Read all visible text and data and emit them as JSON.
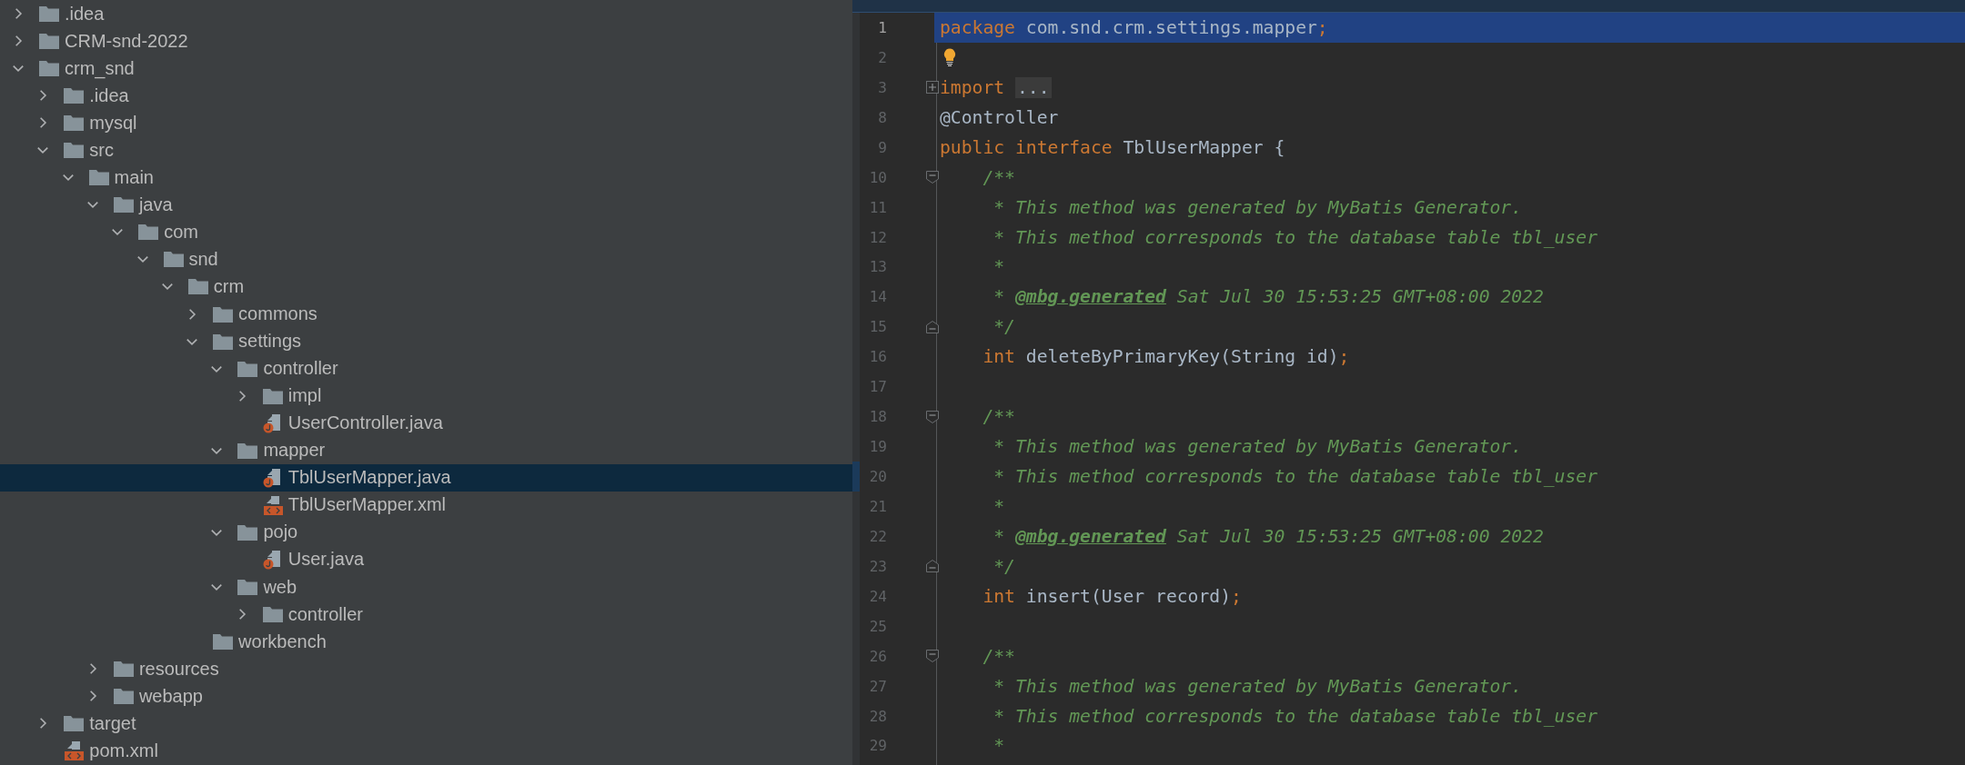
{
  "project_tree": [
    {
      "kind": "folder",
      "label": ".idea",
      "expanded": false,
      "selected": false
    },
    {
      "kind": "folder",
      "label": "CRM-snd-2022",
      "expanded": false,
      "selected": false
    },
    {
      "kind": "folder",
      "label": "crm_snd",
      "expanded": true,
      "selected": false,
      "children": [
        {
          "kind": "folder",
          "label": ".idea",
          "expanded": false,
          "selected": false
        },
        {
          "kind": "folder",
          "label": "mysql",
          "expanded": false,
          "selected": false
        },
        {
          "kind": "folder",
          "label": "src",
          "expanded": true,
          "selected": false,
          "children": [
            {
              "kind": "folder",
              "label": "main",
              "expanded": true,
              "selected": false,
              "children": [
                {
                  "kind": "folder",
                  "label": "java",
                  "expanded": true,
                  "selected": false,
                  "children": [
                    {
                      "kind": "folder",
                      "label": "com",
                      "expanded": true,
                      "selected": false,
                      "children": [
                        {
                          "kind": "folder",
                          "label": "snd",
                          "expanded": true,
                          "selected": false,
                          "children": [
                            {
                              "kind": "folder",
                              "label": "crm",
                              "expanded": true,
                              "selected": false,
                              "children": [
                                {
                                  "kind": "folder",
                                  "label": "commons",
                                  "expanded": false,
                                  "selected": false
                                },
                                {
                                  "kind": "folder",
                                  "label": "settings",
                                  "expanded": true,
                                  "selected": false,
                                  "children": [
                                    {
                                      "kind": "folder",
                                      "label": "controller",
                                      "expanded": true,
                                      "selected": false,
                                      "children": [
                                        {
                                          "kind": "folder",
                                          "label": "impl",
                                          "expanded": false,
                                          "selected": false
                                        },
                                        {
                                          "kind": "java",
                                          "label": "UserController.java",
                                          "selected": false
                                        }
                                      ]
                                    },
                                    {
                                      "kind": "folder",
                                      "label": "mapper",
                                      "expanded": true,
                                      "selected": false,
                                      "children": [
                                        {
                                          "kind": "java",
                                          "label": "TblUserMapper.java",
                                          "selected": true
                                        },
                                        {
                                          "kind": "xml",
                                          "label": "TblUserMapper.xml",
                                          "selected": false
                                        }
                                      ]
                                    },
                                    {
                                      "kind": "folder",
                                      "label": "pojo",
                                      "expanded": true,
                                      "selected": false,
                                      "children": [
                                        {
                                          "kind": "java",
                                          "label": "User.java",
                                          "selected": false
                                        }
                                      ]
                                    },
                                    {
                                      "kind": "folder",
                                      "label": "web",
                                      "expanded": true,
                                      "selected": false,
                                      "children": [
                                        {
                                          "kind": "folder",
                                          "label": "controller",
                                          "expanded": false,
                                          "selected": false
                                        }
                                      ]
                                    }
                                  ]
                                },
                                {
                                  "kind": "empty-folder",
                                  "label": "workbench",
                                  "selected": false
                                }
                              ]
                            }
                          ]
                        }
                      ]
                    }
                  ]
                },
                {
                  "kind": "folder",
                  "label": "resources",
                  "expanded": false,
                  "selected": false
                },
                {
                  "kind": "folder",
                  "label": "webapp",
                  "expanded": false,
                  "selected": false
                }
              ]
            }
          ]
        },
        {
          "kind": "folder",
          "label": "target",
          "expanded": false,
          "selected": false
        },
        {
          "kind": "xml",
          "label": "pom.xml",
          "selected": false
        }
      ]
    }
  ],
  "editor": {
    "lines": [
      {
        "kind": "code",
        "number": "1",
        "current": true,
        "hint": false,
        "changed": false,
        "tokens": [
          {
            "kind": "keyword",
            "text": "package "
          },
          {
            "kind": "plain",
            "text": "com.snd.crm.settings.mapper"
          },
          {
            "kind": "keyword",
            "text": ";"
          }
        ]
      },
      {
        "kind": "code",
        "number": "2",
        "current": false,
        "hint": true,
        "changed": false
      },
      {
        "kind": "fold-collapsed",
        "number": "3",
        "current": false,
        "hint": false,
        "changed": false,
        "tokens": [
          {
            "kind": "keyword",
            "text": "import "
          },
          {
            "kind": "folded",
            "text": "..."
          }
        ]
      },
      {
        "kind": "code",
        "number": "8",
        "current": false,
        "hint": false,
        "changed": false,
        "tokens": [
          {
            "kind": "plain",
            "text": "@Controller"
          }
        ]
      },
      {
        "kind": "code",
        "number": "9",
        "current": false,
        "hint": false,
        "changed": false,
        "tokens": [
          {
            "kind": "keyword",
            "text": "public interface "
          },
          {
            "kind": "plain",
            "text": "TblUserMapper {"
          }
        ]
      },
      {
        "kind": "fold-start",
        "number": "10",
        "current": false,
        "hint": false,
        "changed": false,
        "tokens": [
          {
            "kind": "doc",
            "text": "    /**"
          }
        ]
      },
      {
        "kind": "code",
        "number": "11",
        "current": false,
        "hint": false,
        "changed": false,
        "tokens": [
          {
            "kind": "doc",
            "text": "     * This method was generated by MyBatis Generator."
          }
        ]
      },
      {
        "kind": "code",
        "number": "12",
        "current": false,
        "hint": false,
        "changed": false,
        "tokens": [
          {
            "kind": "doc",
            "text": "     * This method corresponds to the database table tbl_user"
          }
        ]
      },
      {
        "kind": "code",
        "number": "13",
        "current": false,
        "hint": false,
        "changed": false,
        "tokens": [
          {
            "kind": "doc",
            "text": "     *"
          }
        ]
      },
      {
        "kind": "code",
        "number": "14",
        "current": false,
        "hint": false,
        "changed": false,
        "tokens": [
          {
            "kind": "doc",
            "text": "     * "
          },
          {
            "kind": "doctag",
            "text": "@mbg.generated"
          },
          {
            "kind": "doc",
            "text": " Sat Jul 30 15:53:25 GMT+08:00 2022"
          }
        ]
      },
      {
        "kind": "fold-end",
        "number": "15",
        "current": false,
        "hint": false,
        "changed": false,
        "tokens": [
          {
            "kind": "doc",
            "text": "     */"
          }
        ]
      },
      {
        "kind": "code",
        "number": "16",
        "current": false,
        "hint": false,
        "changed": false,
        "tokens": [
          {
            "kind": "keyword",
            "text": "    int "
          },
          {
            "kind": "plain",
            "text": "deleteByPrimaryKey(String id)"
          },
          {
            "kind": "keyword",
            "text": ";"
          }
        ]
      },
      {
        "kind": "code",
        "number": "17",
        "current": false,
        "hint": false,
        "changed": false
      },
      {
        "kind": "fold-start",
        "number": "18",
        "current": false,
        "hint": false,
        "changed": false,
        "tokens": [
          {
            "kind": "doc",
            "text": "    /**"
          }
        ]
      },
      {
        "kind": "code",
        "number": "19",
        "current": false,
        "hint": false,
        "changed": false,
        "tokens": [
          {
            "kind": "doc",
            "text": "     * This method was generated by MyBatis Generator."
          }
        ]
      },
      {
        "kind": "code",
        "number": "20",
        "current": false,
        "hint": false,
        "changed": true,
        "tokens": [
          {
            "kind": "doc",
            "text": "     * This method corresponds to the database table tbl_user"
          }
        ]
      },
      {
        "kind": "code",
        "number": "21",
        "current": false,
        "hint": false,
        "changed": false,
        "tokens": [
          {
            "kind": "doc",
            "text": "     *"
          }
        ]
      },
      {
        "kind": "code",
        "number": "22",
        "current": false,
        "hint": false,
        "changed": false,
        "tokens": [
          {
            "kind": "doc",
            "text": "     * "
          },
          {
            "kind": "doctag",
            "text": "@mbg.generated"
          },
          {
            "kind": "doc",
            "text": " Sat Jul 30 15:53:25 GMT+08:00 2022"
          }
        ]
      },
      {
        "kind": "fold-end",
        "number": "23",
        "current": false,
        "hint": false,
        "changed": false,
        "tokens": [
          {
            "kind": "doc",
            "text": "     */"
          }
        ]
      },
      {
        "kind": "code",
        "number": "24",
        "current": false,
        "hint": false,
        "changed": false,
        "tokens": [
          {
            "kind": "keyword",
            "text": "    int "
          },
          {
            "kind": "plain",
            "text": "insert(User record)"
          },
          {
            "kind": "keyword",
            "text": ";"
          }
        ]
      },
      {
        "kind": "code",
        "number": "25",
        "current": false,
        "hint": false,
        "changed": false
      },
      {
        "kind": "fold-start",
        "number": "26",
        "current": false,
        "hint": false,
        "changed": false,
        "tokens": [
          {
            "kind": "doc",
            "text": "    /**"
          }
        ]
      },
      {
        "kind": "code",
        "number": "27",
        "current": false,
        "hint": false,
        "changed": false,
        "tokens": [
          {
            "kind": "doc",
            "text": "     * This method was generated by MyBatis Generator."
          }
        ]
      },
      {
        "kind": "code",
        "number": "28",
        "current": false,
        "hint": false,
        "changed": false,
        "tokens": [
          {
            "kind": "doc",
            "text": "     * This method corresponds to the database table tbl_user"
          }
        ]
      },
      {
        "kind": "code",
        "number": "29",
        "current": false,
        "hint": false,
        "changed": false,
        "tokens": [
          {
            "kind": "doc",
            "text": "     *"
          }
        ]
      }
    ]
  }
}
